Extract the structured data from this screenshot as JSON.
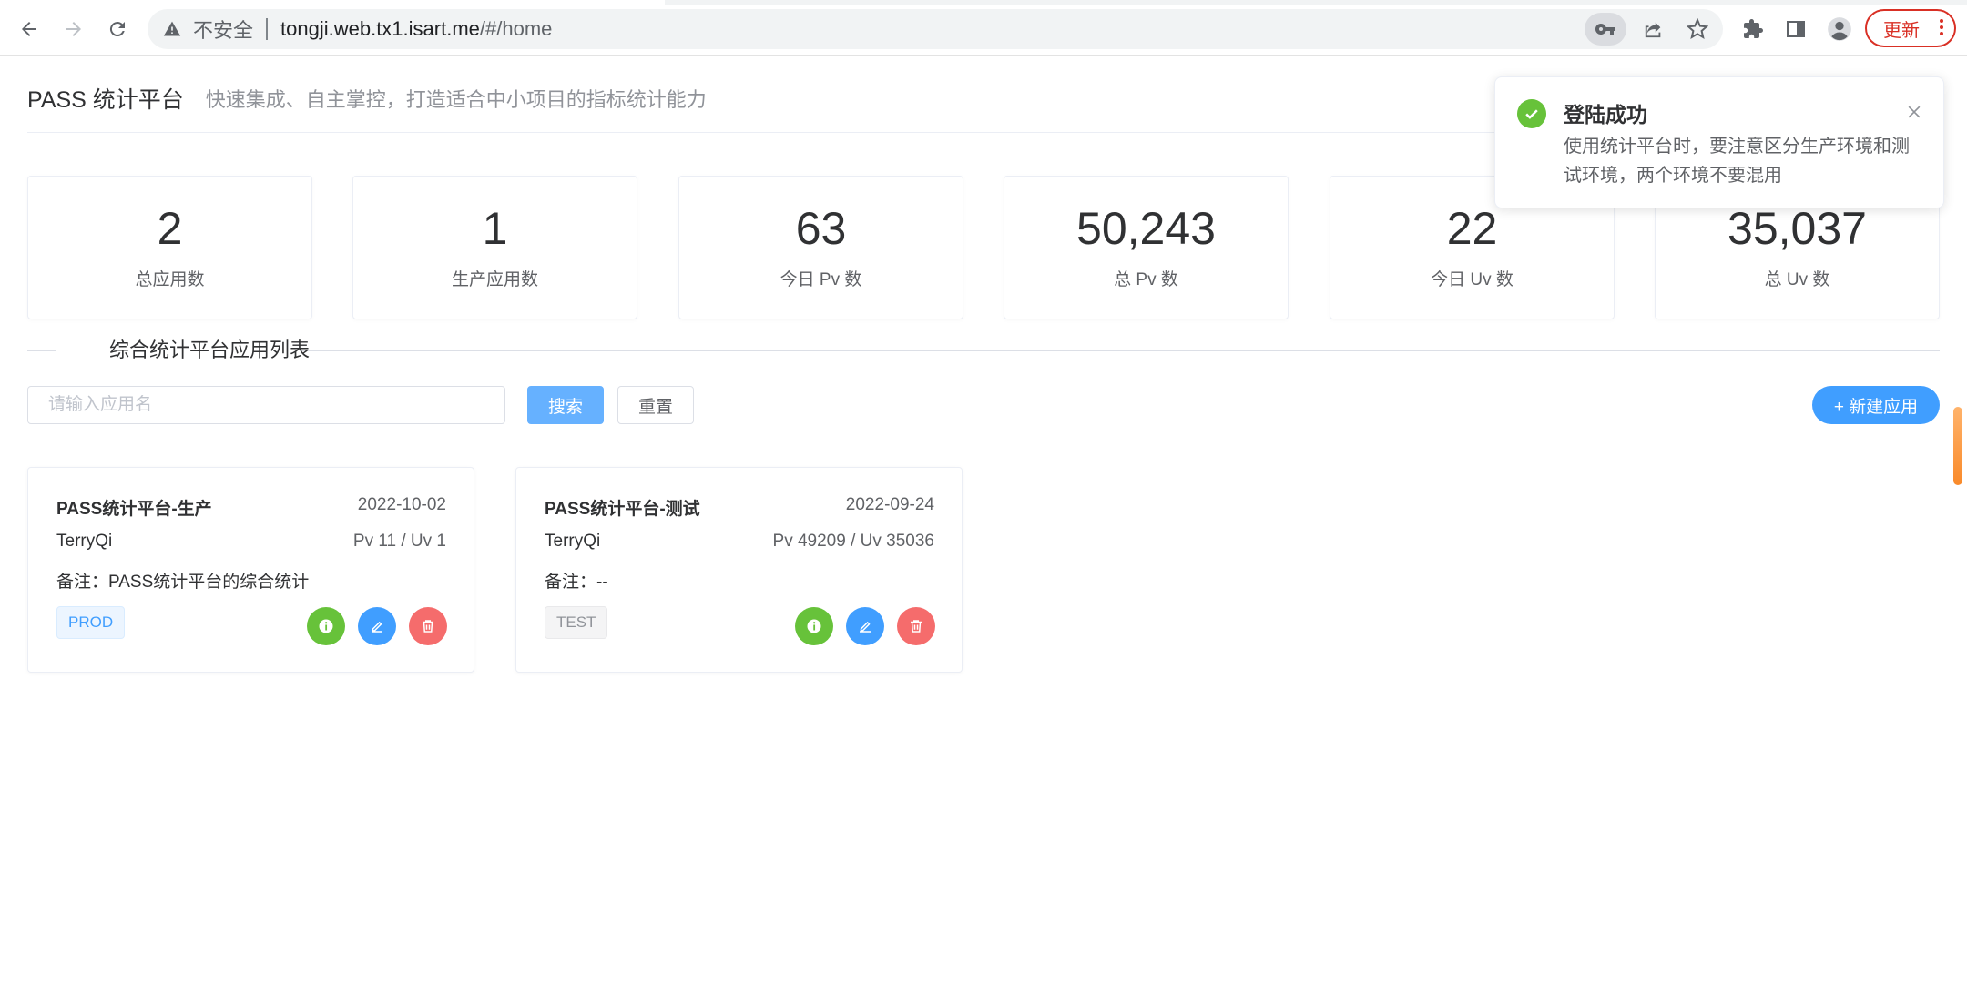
{
  "browser": {
    "insecure_label": "不安全",
    "url_host": "tongji.web.tx1.isart.me",
    "url_path": "/#/home",
    "update_label": "更新"
  },
  "header": {
    "title": "PASS 统计平台",
    "subtitle": "快速集成、自主掌控，打造适合中小项目的指标统计能力"
  },
  "stats": [
    {
      "value": "2",
      "label": "总应用数"
    },
    {
      "value": "1",
      "label": "生产应用数"
    },
    {
      "value": "63",
      "label": "今日 Pv 数"
    },
    {
      "value": "50,243",
      "label": "总 Pv 数"
    },
    {
      "value": "22",
      "label": "今日 Uv 数"
    },
    {
      "value": "35,037",
      "label": "总 Uv 数"
    }
  ],
  "section": {
    "title": "综合统计平台应用列表"
  },
  "toolbar": {
    "search_placeholder": "请输入应用名",
    "search_value": "",
    "search_label": "搜索",
    "reset_label": "重置",
    "new_label": "+ 新建应用"
  },
  "apps": [
    {
      "name": "PASS统计平台-生产",
      "date": "2022-10-02",
      "owner": "TerryQi",
      "stats": "Pv 11 / Uv 1",
      "note": "备注：PASS统计平台的综合统计",
      "tag": "PROD"
    },
    {
      "name": "PASS统计平台-测试",
      "date": "2022-09-24",
      "owner": "TerryQi",
      "stats": "Pv 49209 / Uv 35036",
      "note": "备注：--",
      "tag": "TEST"
    }
  ],
  "notification": {
    "title": "登陆成功",
    "message": "使用统计平台时，要注意区分生产环境和测试环境，两个环境不要混用"
  },
  "colors": {
    "primary": "#409eff",
    "success": "#67c23a",
    "danger": "#f56c6c",
    "update_red": "#d93025"
  }
}
